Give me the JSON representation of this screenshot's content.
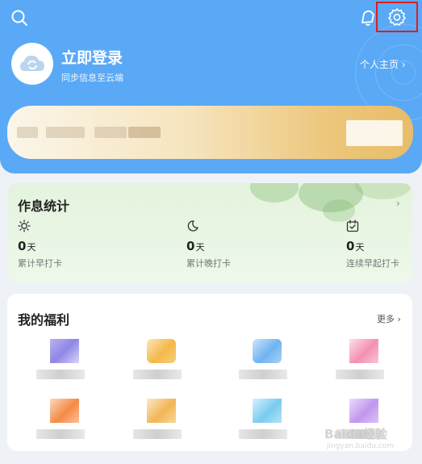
{
  "header": {
    "search_icon": "search-icon",
    "notify_icon": "bell-icon",
    "settings_icon": "gear-icon",
    "highlight_color": "#e11d1d",
    "accent_color": "#5aa9f6"
  },
  "profile": {
    "login_title": "立即登录",
    "login_subtitle": "同步信息至云端",
    "home_link": "个人主页",
    "home_arrow": "›",
    "avatar_icon": "cloud-sync-icon"
  },
  "sleep_stats": {
    "title": "作息统计",
    "arrow": "›",
    "items": [
      {
        "icon": "sun-icon",
        "value": "0",
        "unit": "天",
        "label": "累计早打卡"
      },
      {
        "icon": "moon-icon",
        "value": "0",
        "unit": "天",
        "label": "累计晚打卡"
      },
      {
        "icon": "calendar-check-icon",
        "value": "0",
        "unit": "天",
        "label": "连续早起打卡"
      }
    ]
  },
  "welfare": {
    "title": "我的福利",
    "more": "更多",
    "more_arrow": "›"
  },
  "watermark": {
    "text": "Baidu经验",
    "sub": "jingyan.baidu.com"
  }
}
